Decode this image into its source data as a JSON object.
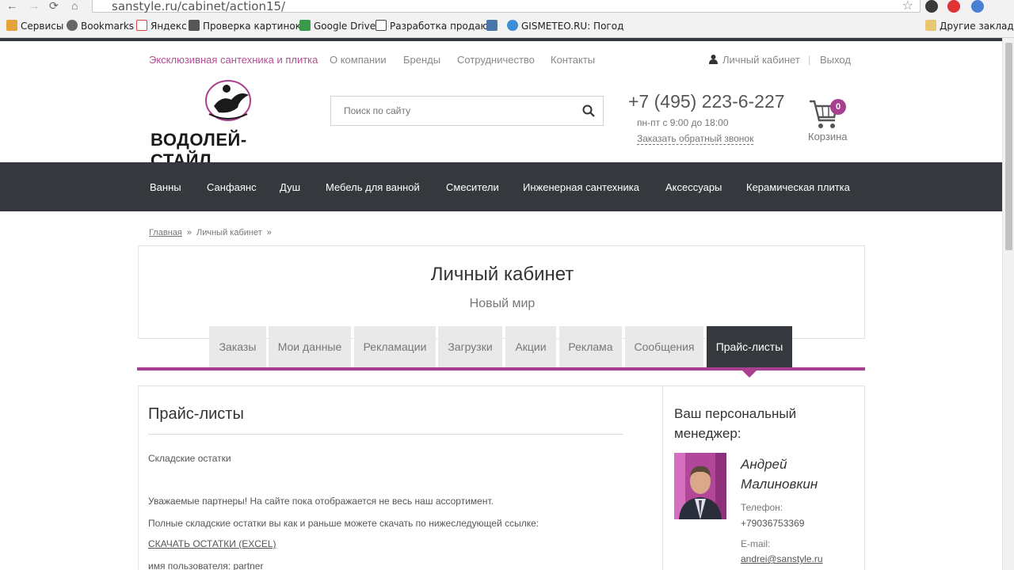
{
  "browser": {
    "url": "sanstyle.ru/cabinet/action15/",
    "bookmarks": [
      "Сервисы",
      "Bookmarks",
      "Яндекс",
      "Проверка картинок",
      "Google Drive",
      "Разработка продаю",
      "GISMETEO.RU: Погод"
    ],
    "other_bookmarks": "Другие закладки"
  },
  "topnav": {
    "tagline": "Эксклюзивная сантехника и плитка",
    "links": [
      "О компании",
      "Бренды",
      "Сотрудничество",
      "Контакты"
    ],
    "account": "Личный кабинет",
    "logout": "Выход"
  },
  "header": {
    "logo_text": "ВОДОЛЕЙ-СТАЙЛ",
    "search_placeholder": "Поиск по сайту",
    "phone": "+7 (495) 223-6-227",
    "hours": "пн-пт с 9:00 до 18:00",
    "callback": "Заказать обратный звонок",
    "cart_count": "0",
    "cart_label": "Корзина"
  },
  "menu": [
    "Ванны",
    "Санфаянс",
    "Душ",
    "Мебель для ванной",
    "Смесители",
    "Инженерная сантехника",
    "Аксессуары",
    "Керамическая плитка"
  ],
  "breadcrumb": {
    "home": "Главная",
    "current": "Личный кабинет",
    "sep": "»"
  },
  "cabinet": {
    "title": "Личный кабинет",
    "subtitle": "Новый мир",
    "tabs": [
      "Заказы",
      "Мои данные",
      "Рекламации",
      "Загрузки",
      "Акции",
      "Реклама",
      "Сообщения",
      "Прайс-листы"
    ],
    "active_tab": "Прайс-листы"
  },
  "content": {
    "title": "Прайс-листы",
    "section": "Складские остатки",
    "p1": "Уважаемые партнеры! На сайте пока отображается не весь наш ассортимент.",
    "p2": "Полные складские остатки вы как и раньше можете скачать по нижеследующей ссылке:",
    "download_link": "СКАЧАТЬ ОСТАТКИ (EXCEL)",
    "username_line": "имя пользователя: partner"
  },
  "manager": {
    "title": "Ваш персональный менеджер:",
    "name": "Андрей Малиновкин",
    "phone_label": "Телефон:",
    "phone": "+79036753369",
    "email_label": "E-mail:",
    "email": "andrei@sanstyle.ru"
  },
  "colors": {
    "accent": "#a8408f",
    "dark": "#35383c"
  }
}
